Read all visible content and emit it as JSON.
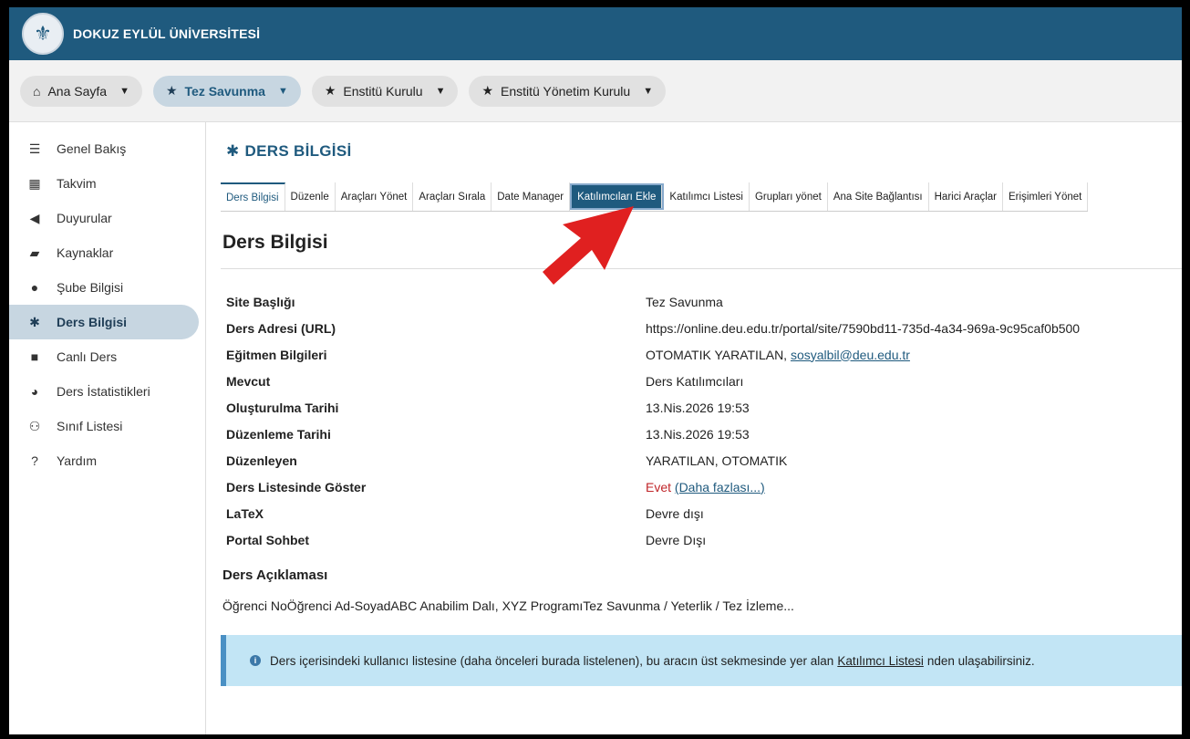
{
  "header": {
    "logo_glyph": "⚜",
    "university": "DOKUZ EYLÜL ÜNİVERSİTESİ"
  },
  "site_tabs": [
    {
      "label": "Ana Sayfa",
      "icon": "home-icon",
      "glyph": "🏠"
    },
    {
      "label": "Tez Savunma",
      "icon": "star-icon",
      "glyph": "★"
    },
    {
      "label": "Enstitü Kurulu",
      "icon": "star-icon",
      "glyph": "★"
    },
    {
      "label": "Enstitü Yönetim Kurulu",
      "icon": "star-icon",
      "glyph": "★"
    }
  ],
  "sidebar": {
    "items": [
      {
        "label": "Genel Bakış",
        "glyph": "☰"
      },
      {
        "label": "Takvim",
        "glyph": "▦"
      },
      {
        "label": "Duyurular",
        "glyph": "📢"
      },
      {
        "label": "Kaynaklar",
        "glyph": "▰"
      },
      {
        "label": "Şube Bilgisi",
        "glyph": "●"
      },
      {
        "label": "Ders Bilgisi",
        "glyph": "✱"
      },
      {
        "label": "Canlı Ders",
        "glyph": "■"
      },
      {
        "label": "Ders İstatistikleri",
        "glyph": "◕"
      },
      {
        "label": "Sınıf Listesi",
        "glyph": "⚇"
      },
      {
        "label": "Yardım",
        "glyph": "?"
      }
    ]
  },
  "page": {
    "title": "DERS BİLGİSİ",
    "gear": "✱",
    "tool_tabs": [
      "Ders Bilgisi",
      "Düzenle",
      "Araçları Yönet",
      "Araçları Sırala",
      "Date Manager",
      "Katılımcıları Ekle",
      "Katılımcı Listesi",
      "Grupları yönet",
      "Ana Site Bağlantısı",
      "Harici Araçlar",
      "Erişimleri Yönet"
    ],
    "content_title": "Ders Bilgisi",
    "info": [
      {
        "label": "Site Başlığı",
        "value": "Tez Savunma"
      },
      {
        "label": "Ders Adresi (URL)",
        "value": "https://online.deu.edu.tr/portal/site/7590bd11-735d-4a34-969a-9c95caf0b500"
      },
      {
        "label": "Eğitmen Bilgileri",
        "value": "OTOMATIK YARATILAN,",
        "link": "sosyalbil@deu.edu.tr"
      },
      {
        "label": "Mevcut",
        "value": "Ders Katılımcıları"
      },
      {
        "label": "Oluşturulma Tarihi",
        "value": "13.Nis.2026 19:53"
      },
      {
        "label": "Düzenleme Tarihi",
        "value": "13.Nis.2026 19:53"
      },
      {
        "label": "Düzenleyen",
        "value": "YARATILAN, OTOMATIK"
      },
      {
        "label": "Ders Listesinde Göster",
        "value": "Evet",
        "link": "(Daha fazlası...)"
      },
      {
        "label": "LaTeX",
        "value": "Devre dışı"
      },
      {
        "label": "Portal Sohbet",
        "value": "Devre Dışı"
      }
    ],
    "description_heading": "Ders Açıklaması",
    "description_text": "Öğrenci NoÖğrenci Ad-SoyadABC Anabilim Dalı, XYZ ProgramıTez Savunma / Yeterlik / Tez İzleme...",
    "notice": {
      "before": "Ders içerisindeki kullanıcı listesine (daha önceleri burada listelenen), bu aracın üst sekmesinde yer alan",
      "link": "Katılımcı Listesi",
      "after": "nden ulaşabilirsiniz."
    }
  },
  "colors": {
    "brand": "#1f5a7e",
    "active_bg": "#c7d6e1",
    "notice_bg": "#c2e5f5",
    "arrow": "#e02020"
  }
}
